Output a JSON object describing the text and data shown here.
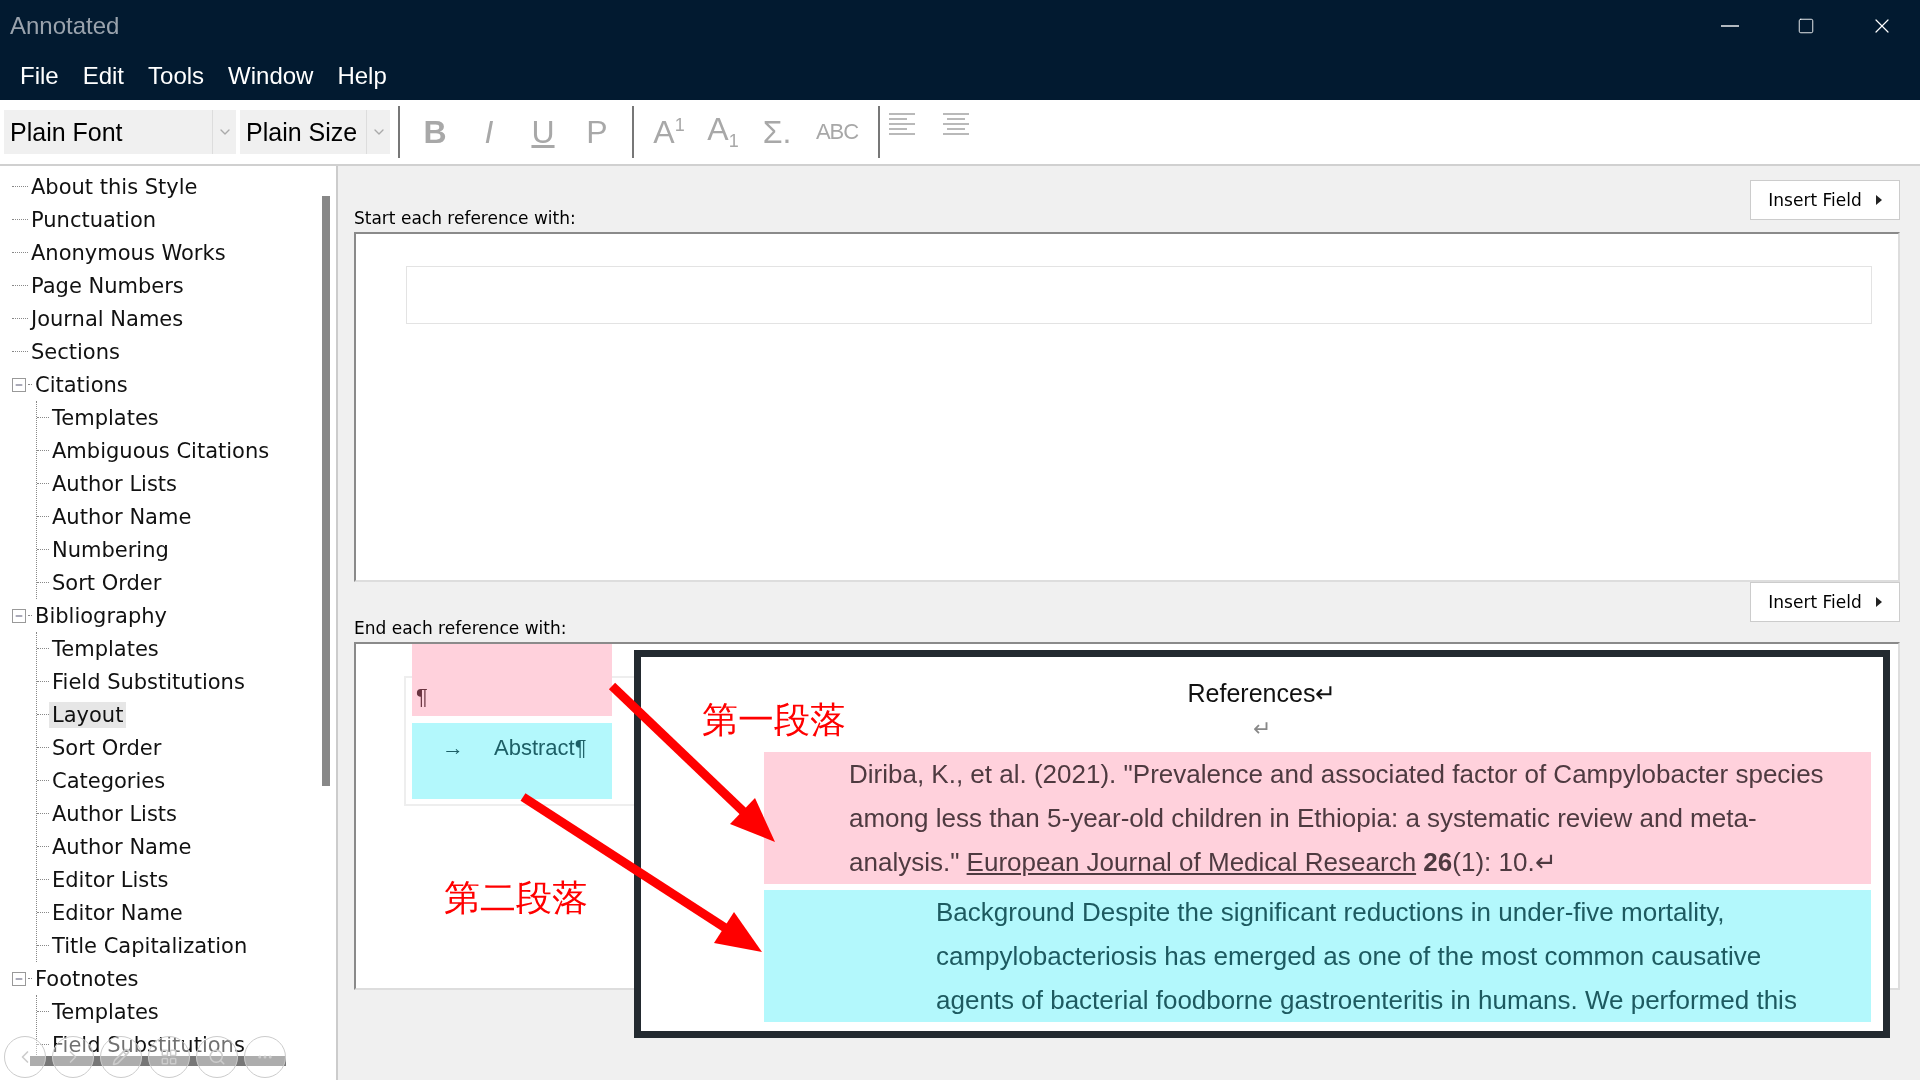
{
  "window": {
    "title": "Annotated"
  },
  "menu": [
    "File",
    "Edit",
    "Tools",
    "Window",
    "Help"
  ],
  "toolbar": {
    "font": "Plain Font",
    "size": "Plain Size",
    "buttons": [
      {
        "kind": "bold",
        "label": "B",
        "disabled": true
      },
      {
        "kind": "italic",
        "label": "I",
        "disabled": true
      },
      {
        "kind": "underline",
        "label": "U",
        "disabled": true
      },
      {
        "kind": "plain",
        "label": "P",
        "disabled": true
      },
      {
        "kind": "separator"
      },
      {
        "kind": "plain",
        "label": "A$^{1}$",
        "disabled": true
      },
      {
        "kind": "plain",
        "label": "A$_{1}$",
        "disabled": true
      },
      {
        "kind": "plain",
        "label": "Σ.",
        "disabled": true
      },
      {
        "kind": "small",
        "label": "ABC",
        "disabled": true
      },
      {
        "kind": "separator"
      },
      {
        "kind": "align-left",
        "disabled": true
      },
      {
        "kind": "align-center",
        "disabled": true
      }
    ]
  },
  "sidebar": {
    "items": [
      {
        "label": "About this Style",
        "selected": false
      },
      {
        "label": "Punctuation",
        "selected": false
      },
      {
        "label": "Anonymous Works",
        "selected": false
      },
      {
        "label": "Page Numbers",
        "selected": false
      },
      {
        "label": "Journal Names",
        "selected": false
      },
      {
        "label": "Sections",
        "selected": false
      },
      {
        "label": "Citations",
        "selected": false,
        "expanded": true,
        "children": [
          {
            "label": "Templates",
            "selected": false
          },
          {
            "label": "Ambiguous Citations",
            "selected": false
          },
          {
            "label": "Author Lists",
            "selected": false
          },
          {
            "label": "Author Name",
            "selected": false
          },
          {
            "label": "Numbering",
            "selected": false
          },
          {
            "label": "Sort Order",
            "selected": false
          }
        ]
      },
      {
        "label": "Bibliography",
        "selected": false,
        "expanded": true,
        "children": [
          {
            "label": "Templates",
            "selected": false
          },
          {
            "label": "Field Substitutions",
            "selected": false
          },
          {
            "label": "Layout",
            "selected": true
          },
          {
            "label": "Sort Order",
            "selected": false
          },
          {
            "label": "Categories",
            "selected": false
          },
          {
            "label": "Author Lists",
            "selected": false
          },
          {
            "label": "Author Name",
            "selected": false
          },
          {
            "label": "Editor Lists",
            "selected": false
          },
          {
            "label": "Editor Name",
            "selected": false
          },
          {
            "label": "Title Capitalization",
            "selected": false
          }
        ]
      },
      {
        "label": "Footnotes",
        "selected": false,
        "expanded": true,
        "children": [
          {
            "label": "Templates",
            "selected": false
          },
          {
            "label": "Field Substitutions",
            "selected": false
          }
        ]
      }
    ]
  },
  "start_section": {
    "label": "Start each reference with:",
    "button": "Insert Field"
  },
  "end_section": {
    "label": "End each reference with:",
    "button": "Insert Field",
    "pilcrow": "¶",
    "tab_arrow": "→",
    "text": "Abstract¶"
  },
  "annotation": {
    "heading": "References↵",
    "blank_mark": "↵",
    "labels": [
      "第一段落",
      "第二段落"
    ],
    "paragraph_1": {
      "lines": [
        "Diriba, K., et al. (2021). \"Prevalence and associated factor of Campylobacter species",
        "among less than 5-year-old children in Ethiopia: a systematic review and meta-"
      ],
      "last_line": [
        {
          "kind": "plain",
          "text": "analysis.\" "
        },
        {
          "kind": "underline",
          "text": "European Journal of Medical Research"
        },
        {
          "kind": "bold",
          "text": "26"
        },
        {
          "kind": "plain",
          "text": "(1): 10.↵"
        }
      ]
    },
    "paragraph_2": {
      "lines": [
        "Background Despite the significant reductions in under-five mortality,",
        "campylobacteriosis has emerged as one of the most common causative",
        "agents of bacterial foodborne gastroenteritis in humans. We performed this"
      ]
    }
  }
}
